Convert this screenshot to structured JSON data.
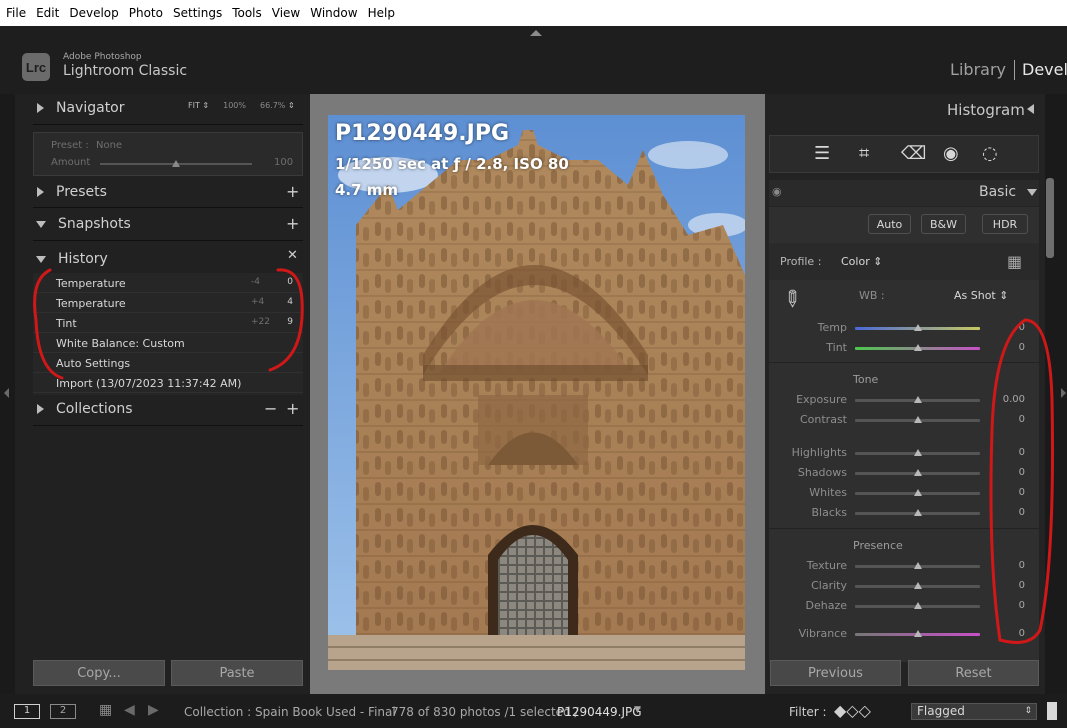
{
  "menu": [
    "File",
    "Edit",
    "Develop",
    "Photo",
    "Settings",
    "Tools",
    "View",
    "Window",
    "Help"
  ],
  "app": {
    "logo": "Lrc",
    "vendor": "Adobe Photoshop",
    "name": "Lightroom Classic",
    "modules": [
      "Library",
      "Develop"
    ]
  },
  "navigator": {
    "title": "Navigator",
    "fit": "FIT",
    "zoom1": "100%",
    "zoom2": "66.7%",
    "preset_label": "Preset :",
    "preset_value": "None",
    "amount_label": "Amount",
    "amount_value": "100"
  },
  "presets": {
    "title": "Presets"
  },
  "snapshots": {
    "title": "Snapshots"
  },
  "history": {
    "title": "History",
    "items": [
      {
        "name": "Temperature",
        "from": "-4",
        "to": "0"
      },
      {
        "name": "Temperature",
        "from": "+4",
        "to": "4"
      },
      {
        "name": "Tint",
        "from": "+22",
        "to": "9"
      },
      {
        "name": "White Balance: Custom",
        "from": "",
        "to": ""
      },
      {
        "name": "Auto Settings",
        "from": "",
        "to": ""
      },
      {
        "name": "Import (13/07/2023 11:37:42 AM)",
        "from": "",
        "to": ""
      }
    ]
  },
  "collections": {
    "title": "Collections"
  },
  "left_buttons": {
    "copy": "Copy...",
    "paste": "Paste"
  },
  "photo": {
    "filename": "P1290449.JPG",
    "exposure": "1/1250 sec at ƒ / 2.8, ISO 80",
    "focal": "4.7 mm"
  },
  "right": {
    "histogram_title": "Histogram",
    "basic_title": "Basic",
    "auto": "Auto",
    "bw": "B&W",
    "hdr": "HDR",
    "profile_label": "Profile :",
    "profile_value": "Color",
    "wb_label": "WB :",
    "wb_value": "As Shot",
    "tone_head": "Tone",
    "presence_head": "Presence",
    "adjustments": [
      {
        "label": "Temp",
        "value": "0",
        "level": 0.5
      },
      {
        "label": "Tint",
        "value": "0",
        "level": 0.5
      },
      {
        "label": "Exposure",
        "value": "0.00",
        "level": 0.5
      },
      {
        "label": "Contrast",
        "value": "0",
        "level": 0.5
      },
      {
        "label": "Highlights",
        "value": "0",
        "level": 0.5
      },
      {
        "label": "Shadows",
        "value": "0",
        "level": 0.5
      },
      {
        "label": "Whites",
        "value": "0",
        "level": 0.5
      },
      {
        "label": "Blacks",
        "value": "0",
        "level": 0.5
      },
      {
        "label": "Texture",
        "value": "0",
        "level": 0.5
      },
      {
        "label": "Clarity",
        "value": "0",
        "level": 0.5
      },
      {
        "label": "Dehaze",
        "value": "0",
        "level": 0.5
      },
      {
        "label": "Vibrance",
        "value": "0",
        "level": 0.5
      }
    ],
    "previous": "Previous",
    "reset": "Reset"
  },
  "filmstrip": {
    "screen1": "1",
    "screen2": "2",
    "collection": "Collection : Spain Book Used - Final",
    "count": "778 of 830 photos /1 selected /",
    "file": "P1290449.JPG",
    "filter_label": "Filter :",
    "filter_value": "Flagged"
  },
  "colors": {
    "annotation": "#d01818",
    "panel": "#232323",
    "photo_sky": "#6f9fd8",
    "stone": "#b0855a"
  }
}
